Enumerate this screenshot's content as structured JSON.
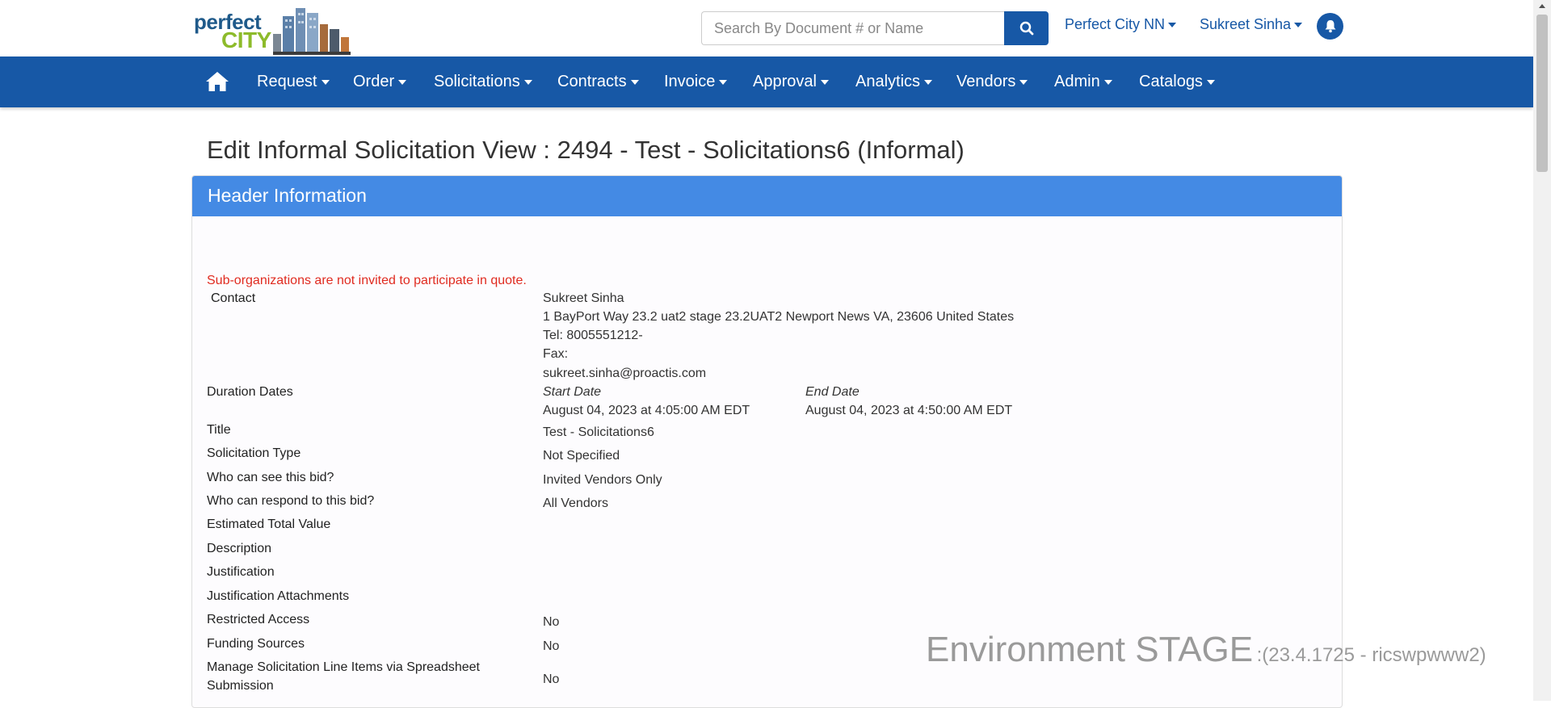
{
  "logo": {
    "line1": "perfect",
    "line2": "CITY"
  },
  "search": {
    "placeholder": "Search By Document # or Name"
  },
  "top_links": {
    "org": "Perfect City NN",
    "user": "Sukreet Sinha"
  },
  "nav": {
    "items": [
      "Request",
      "Order",
      "Solicitations",
      "Contracts",
      "Invoice",
      "Approval",
      "Analytics",
      "Vendors",
      "Admin",
      "Catalogs"
    ]
  },
  "page_title": "Edit Informal Solicitation View : 2494 - Test - Solicitations6 (Informal)",
  "panel": {
    "title": "Header Information",
    "warning": "Sub-organizations are not invited to participate in quote.",
    "contact": {
      "label": "Contact",
      "name": "Sukreet Sinha",
      "address": "1 BayPort Way 23.2 uat2 stage 23.2UAT2 Newport News VA, 23606 United States",
      "tel": "Tel: 8005551212-",
      "fax": "Fax:",
      "email": "sukreet.sinha@proactis.com"
    },
    "duration": {
      "label": "Duration Dates",
      "start_label": "Start Date",
      "start_value": "August 04, 2023 at 4:05:00 AM EDT",
      "end_label": "End Date",
      "end_value": "August 04, 2023 at 4:50:00 AM EDT"
    },
    "fields": [
      {
        "label": "Title",
        "value": "Test - Solicitations6"
      },
      {
        "label": "Solicitation Type",
        "value": "Not Specified"
      },
      {
        "label": "Who can see this bid?",
        "value": "Invited Vendors Only"
      },
      {
        "label": "Who can respond to this bid?",
        "value": "All Vendors"
      },
      {
        "label": "Estimated Total Value",
        "value": ""
      },
      {
        "label": "Description",
        "value": ""
      },
      {
        "label": "Justification",
        "value": ""
      },
      {
        "label": "Justification Attachments",
        "value": ""
      },
      {
        "label": "Restricted Access",
        "value": "No"
      },
      {
        "label": "Funding Sources",
        "value": "No"
      },
      {
        "label_line1": "Manage Solicitation Line Items via Spreadsheet",
        "label_line2": "Submission",
        "value": "No"
      }
    ]
  },
  "environment": {
    "main": "Environment STAGE",
    "detail": ":(23.4.1725 - ricswpwww2)"
  },
  "colors": {
    "brand": "#1758a6",
    "panel_header": "#448ae4",
    "warning": "#e02b20"
  }
}
